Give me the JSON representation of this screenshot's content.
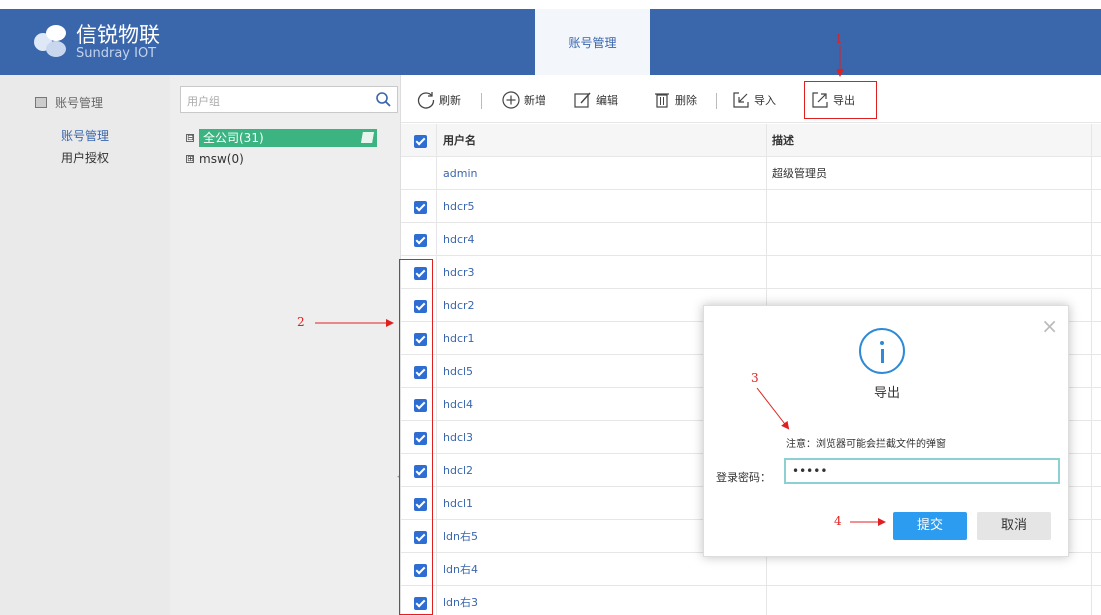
{
  "brand": {
    "name_cn": "信锐物联",
    "name_en": "Sundray IOT"
  },
  "header": {
    "active_tab": "账号管理"
  },
  "sidebar": {
    "group_label": "账号管理",
    "items": [
      {
        "label": "账号管理",
        "active": true
      },
      {
        "label": "用户授权",
        "active": false
      }
    ]
  },
  "tree": {
    "search_placeholder": "用户组",
    "nodes": [
      {
        "label": "全公司(31)",
        "expand": "⊟",
        "selected": true
      },
      {
        "label": "msw(0)",
        "expand": "⊞",
        "selected": false
      }
    ]
  },
  "toolbar": {
    "refresh": "刷新",
    "add": "新增",
    "edit": "编辑",
    "delete": "删除",
    "import": "导入",
    "export": "导出"
  },
  "table": {
    "columns": [
      "用户名",
      "描述"
    ],
    "rows": [
      {
        "name": "admin",
        "desc": "超级管理员",
        "checked": false
      },
      {
        "name": "hdcr5",
        "desc": "",
        "checked": true
      },
      {
        "name": "hdcr4",
        "desc": "",
        "checked": true
      },
      {
        "name": "hdcr3",
        "desc": "",
        "checked": true
      },
      {
        "name": "hdcr2",
        "desc": "",
        "checked": true
      },
      {
        "name": "hdcr1",
        "desc": "",
        "checked": true
      },
      {
        "name": "hdcl5",
        "desc": "",
        "checked": true
      },
      {
        "name": "hdcl4",
        "desc": "",
        "checked": true
      },
      {
        "name": "hdcl3",
        "desc": "",
        "checked": true
      },
      {
        "name": "hdcl2",
        "desc": "",
        "checked": true
      },
      {
        "name": "hdcl1",
        "desc": "",
        "checked": true
      },
      {
        "name": "ldn右5",
        "desc": "",
        "checked": true
      },
      {
        "name": "ldn右4",
        "desc": "",
        "checked": true
      },
      {
        "name": "ldn右3",
        "desc": "",
        "checked": true
      }
    ]
  },
  "dialog": {
    "title": "导出",
    "note": "注意：浏览器可能会拦截文件的弹窗",
    "password_label": "登录密码：",
    "password_value": "•••••",
    "submit_label": "提交",
    "cancel_label": "取消",
    "close_glyph": "×"
  },
  "annotations": {
    "a1": "1",
    "a2": "2",
    "a3": "3",
    "a4": "4"
  },
  "colors": {
    "header": "#3a66ac",
    "accent": "#2b9cf0",
    "annotation": "#e02020",
    "tree_selected": "#3cb482"
  }
}
